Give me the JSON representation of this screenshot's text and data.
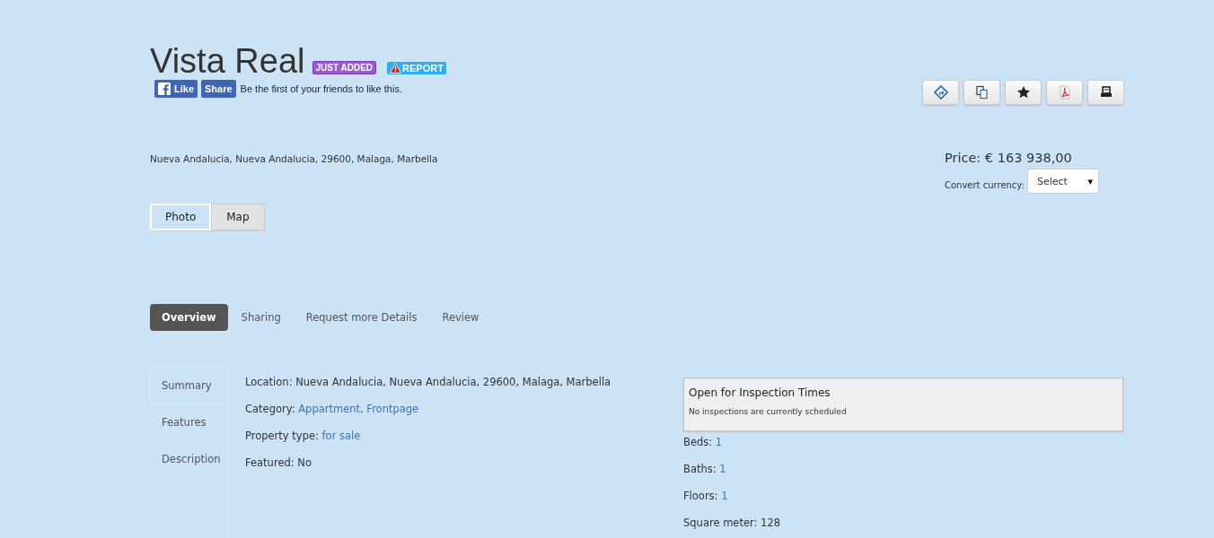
{
  "title": "Vista Real",
  "badges": [
    {
      "label": "JUST ADDED",
      "kind": "new"
    },
    {
      "label": "REPORT",
      "kind": "report"
    }
  ],
  "social": {
    "like": "Like",
    "share": "Share",
    "text": "Be the first of your friends to like this."
  },
  "address": "Nueva Andalucia, Nueva Andalucia, 29600, Malaga, Marbella",
  "price": "Price: € 163 938,00",
  "currency": {
    "label": "Convert currency:",
    "value": "Select",
    "caret": "▾"
  },
  "media_tabs": [
    {
      "label": "Photo",
      "selected": true
    },
    {
      "label": "Map",
      "selected": false
    }
  ],
  "tabs": [
    {
      "label": "Overview",
      "selected": true
    },
    {
      "label": "Sharing",
      "selected": false
    },
    {
      "label": "Request more Details",
      "selected": false
    },
    {
      "label": "Review",
      "selected": false
    }
  ],
  "side_tabs": [
    {
      "label": "Summary",
      "selected": true
    },
    {
      "label": "Features",
      "selected": false
    },
    {
      "label": "Description",
      "selected": false
    }
  ],
  "summary": [
    {
      "label": "Location:",
      "value": "Nueva Andalucia, Nueva Andalucia, 29600, Malaga, Marbella",
      "linked": false
    },
    {
      "label": "Category:",
      "value": "Appartment, Frontpage",
      "linked": true
    },
    {
      "label": "Property type:",
      "value": "for sale",
      "linked": true
    },
    {
      "label": "Featured:",
      "value": "No",
      "linked": false
    }
  ],
  "inspection": {
    "title": "Open for Inspection Times",
    "text": "No inspections are currently scheduled"
  },
  "facts": [
    {
      "label": "Beds:",
      "value": "1",
      "linked": true
    },
    {
      "label": "Baths:",
      "value": "1",
      "linked": true
    },
    {
      "label": "Floors:",
      "value": "1",
      "linked": true
    },
    {
      "label": "Square meter:",
      "value": "128",
      "linked": false
    }
  ]
}
